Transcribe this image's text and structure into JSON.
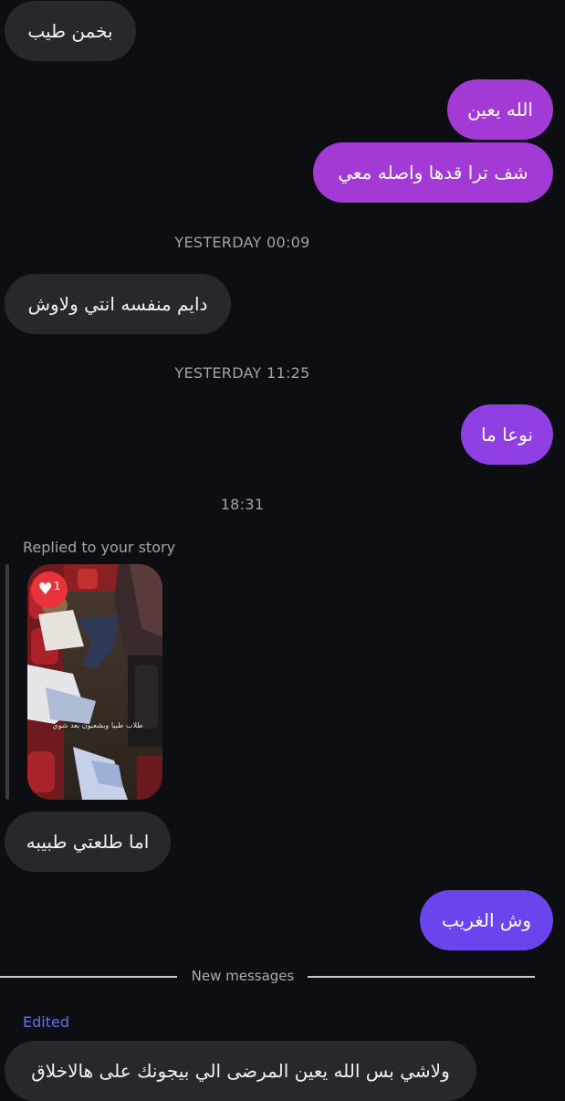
{
  "messages": {
    "m1": "بخمن طيب",
    "m2": "الله يعين",
    "m3": "شف ترا قدها واصله معي",
    "m4": "دايم منفسه انتي ولاوش",
    "m5": "نوعا ما",
    "m6": "اما طلعتي طبيبه",
    "m7": "وش الغريب",
    "m8": "ولاشي بس الله يعين المرضى الي بيجونك على هالاخلاق"
  },
  "timestamps": {
    "t1": "YESTERDAY 00:09",
    "t2": "YESTERDAY 11:25",
    "t3": "18:31"
  },
  "story_reply": {
    "label": "Replied to your story",
    "like_count": "1",
    "caption": "طلاب طبيا ويشعبون بعد شوي"
  },
  "divider": {
    "label": "New messages"
  },
  "edited": {
    "label": "Edited"
  },
  "colors": {
    "background": "#0c0e12",
    "received_bubble": "#26282c",
    "sent_purple": "#9b3fd9",
    "sent_violet": "#6a45ee",
    "edited_label": "#6a6ff2",
    "like_badge": "#e8333b"
  },
  "icons": {
    "like": "heart-icon"
  }
}
